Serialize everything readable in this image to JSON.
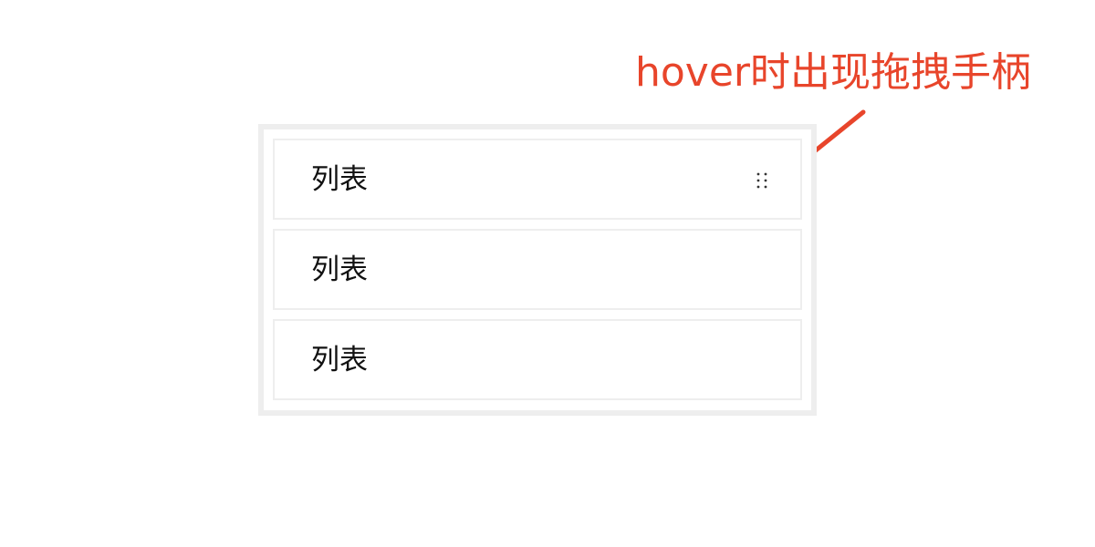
{
  "annotation": {
    "text": "hover时出现拖拽手柄",
    "color": "#e8452b"
  },
  "list": {
    "items": [
      {
        "label": "列表",
        "hovered": true
      },
      {
        "label": "列表",
        "hovered": false
      },
      {
        "label": "列表",
        "hovered": false
      }
    ]
  },
  "icons": {
    "drag_handle": "grip-vertical-icon",
    "pointer": "arrow-icon"
  },
  "colors": {
    "border": "#eeeeee",
    "text": "#111111",
    "accent": "#e8452b"
  }
}
